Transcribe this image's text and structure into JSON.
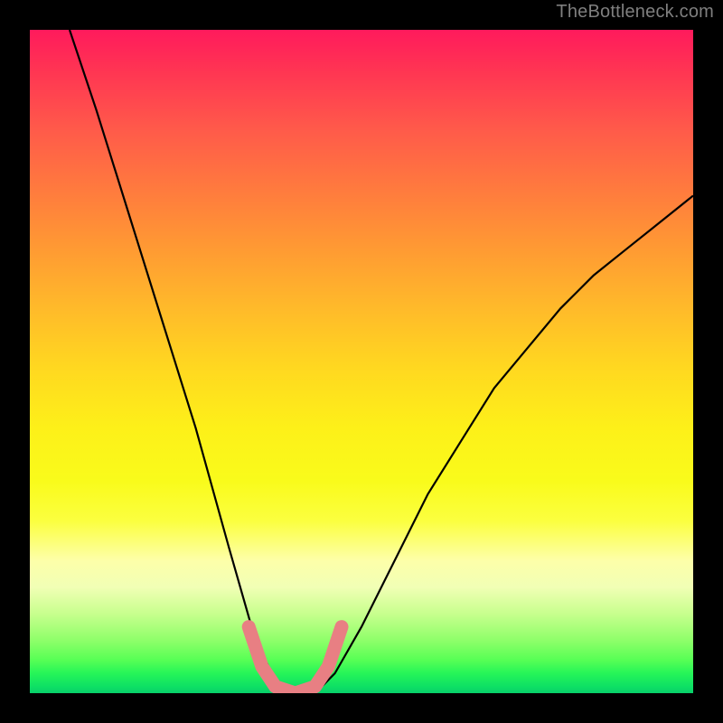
{
  "watermark": "TheBottleneck.com",
  "chart_data": {
    "type": "line",
    "title": "",
    "xlabel": "",
    "ylabel": "",
    "xlim": [
      0,
      100
    ],
    "ylim": [
      0,
      100
    ],
    "grid": false,
    "legend": false,
    "annotations": [],
    "background": "vertical_heat_gradient_red_to_green",
    "series": [
      {
        "name": "bottleneck-curve",
        "color": "#000000",
        "x": [
          6,
          10,
          15,
          20,
          25,
          30,
          34,
          36,
          38,
          40,
          42,
          44,
          46,
          50,
          55,
          60,
          65,
          70,
          75,
          80,
          85,
          90,
          95,
          100
        ],
        "y": [
          100,
          88,
          72,
          56,
          40,
          22,
          8,
          4,
          1,
          0,
          0,
          1,
          3,
          10,
          20,
          30,
          38,
          46,
          52,
          58,
          63,
          67,
          71,
          75
        ]
      }
    ],
    "highlight_segment": {
      "name": "optimal-zone",
      "color": "#e87f83",
      "x": [
        33,
        35,
        37,
        40,
        43,
        45,
        47
      ],
      "y": [
        10,
        4,
        1,
        0,
        1,
        4,
        10
      ]
    }
  }
}
